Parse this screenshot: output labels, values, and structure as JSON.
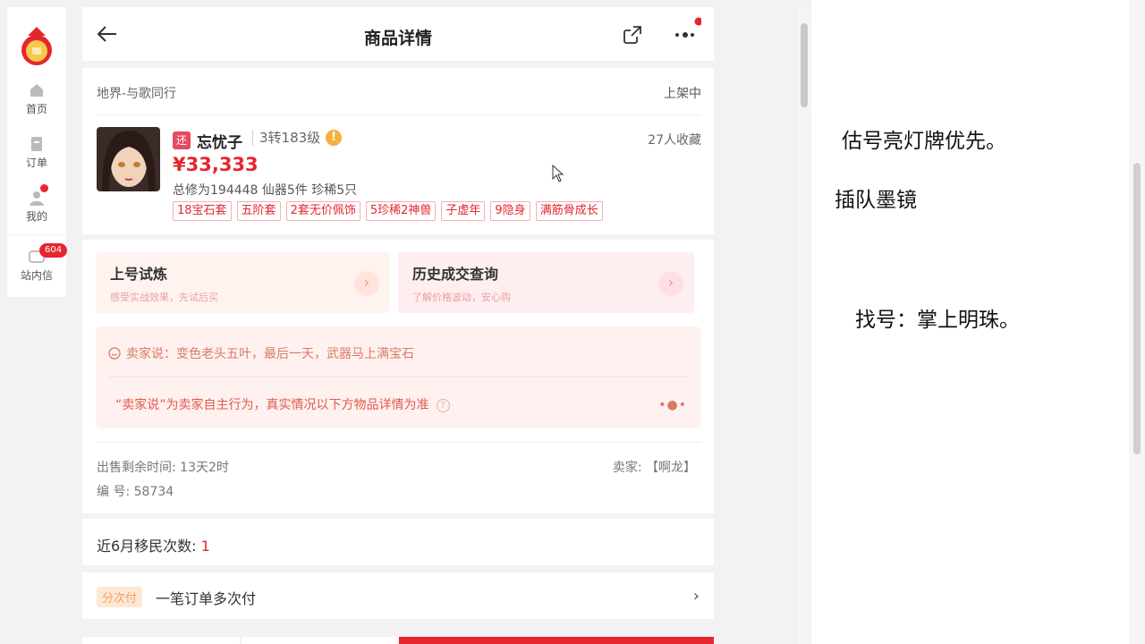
{
  "sidebar": {
    "items": [
      {
        "label": "首页",
        "icon": "home-icon"
      },
      {
        "label": "订单",
        "icon": "order-icon"
      },
      {
        "label": "我的",
        "icon": "user-icon"
      }
    ],
    "messages": {
      "label": "站内信",
      "badge": "604",
      "icon": "mail-icon"
    }
  },
  "header": {
    "title": "商品详情"
  },
  "listing": {
    "server": "地界-与歌同行",
    "status": "上架中",
    "return_tag": "还",
    "role_name": "忘忧子",
    "level": "3转183级",
    "favorites": "27人收藏",
    "price": "¥33,333",
    "attributes": "总修为194448  仙器5件  珍稀5只",
    "tags": [
      "18宝石套",
      "五阶套",
      "2套无价佩饰",
      "5珍稀2神兽",
      "子虚年",
      "9隐身",
      "满筋骨成长"
    ]
  },
  "promos": [
    {
      "title": "上号试炼",
      "subtitle": "感受实战效果，先试后买"
    },
    {
      "title": "历史成交查询",
      "subtitle": "了解价格波动，安心购"
    }
  ],
  "seller_note": {
    "message": "卖家说：变色老头五叶，最后一天，武器马上满宝石",
    "disclaimer": "“卖家说”为卖家自主行为，真实情况以下方物品详情为准"
  },
  "meta": {
    "remaining": "出售剩余时间: 13天2时",
    "seller": "卖家: 【啊龙】",
    "serial": "编 号: 58734"
  },
  "migration": {
    "label": "近6月移民次数:",
    "value": "1"
  },
  "payment": {
    "tag": "分次付",
    "text": "一笔订单多次付"
  },
  "notes": {
    "line1": "估号亮灯牌优先。",
    "line2": "插队墨镜",
    "line3": "找号：掌上明珠。"
  },
  "colors": {
    "accent": "#e5262f",
    "seller_bg": "#fff1ef"
  }
}
